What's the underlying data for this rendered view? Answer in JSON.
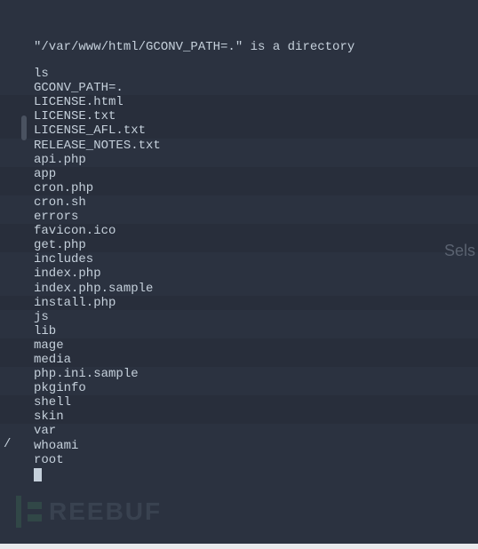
{
  "terminal": {
    "quoted_line": "\"/var/www/html/GCONV_PATH=.\" is a directory",
    "command": "ls",
    "output": [
      "GCONV_PATH=.",
      "LICENSE.html",
      "LICENSE.txt",
      "LICENSE_AFL.txt",
      "RELEASE_NOTES.txt",
      "api.php",
      "app",
      "cron.php",
      "cron.sh",
      "errors",
      "favicon.ico",
      "get.php",
      "includes",
      "index.php",
      "index.php.sample",
      "install.php",
      "js",
      "lib",
      "mage",
      "media",
      "php.ini.sample",
      "pkginfo",
      "shell",
      "skin",
      "var"
    ],
    "command2": "whoami",
    "result2": "root"
  },
  "left_slash": "/",
  "right_partial": "Sels",
  "watermark": {
    "text": "REEBUF"
  }
}
